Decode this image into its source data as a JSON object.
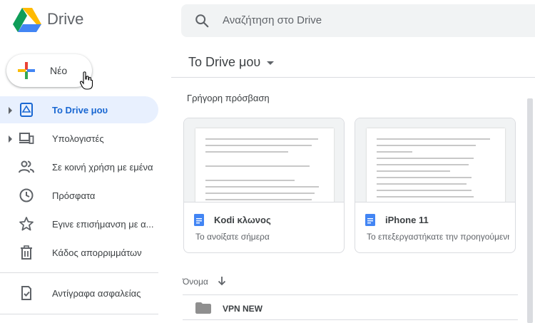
{
  "header": {
    "app_title": "Drive",
    "search_placeholder": "Αναζήτηση στο Drive"
  },
  "sidebar": {
    "new_label": "Νέο",
    "items": [
      {
        "label": "Το Drive μου",
        "icon": "my-drive-icon",
        "active": true
      },
      {
        "label": "Υπολογιστές",
        "icon": "computers-icon"
      },
      {
        "label": "Σε κοινή χρήση με εμένα",
        "icon": "shared-icon"
      },
      {
        "label": "Πρόσφατα",
        "icon": "clock-icon"
      },
      {
        "label": "Εγινε επισήμανση με α...",
        "icon": "star-icon"
      },
      {
        "label": "Κάδος απορριμμάτων",
        "icon": "trash-icon"
      },
      {
        "label": "Αντίγραφα ασφαλείας",
        "icon": "backup-icon"
      }
    ]
  },
  "main": {
    "title": "Το Drive μου",
    "quick_access_title": "Γρήγορη πρόσβαση",
    "cards": [
      {
        "name": "Kodi κλωνος",
        "subtitle": "Το ανοίξατε σήμερα"
      },
      {
        "name": "iPhone 11",
        "subtitle": "Το επεξεργαστήκατε την προηγούμενη"
      }
    ],
    "list_header": "Όνομα",
    "rows": [
      {
        "name": "VPN NEW",
        "icon": "folder-icon"
      }
    ]
  },
  "colors": {
    "accent": "#1967d2",
    "active_bg": "#e8f0fe",
    "docs_blue": "#4285f4"
  }
}
